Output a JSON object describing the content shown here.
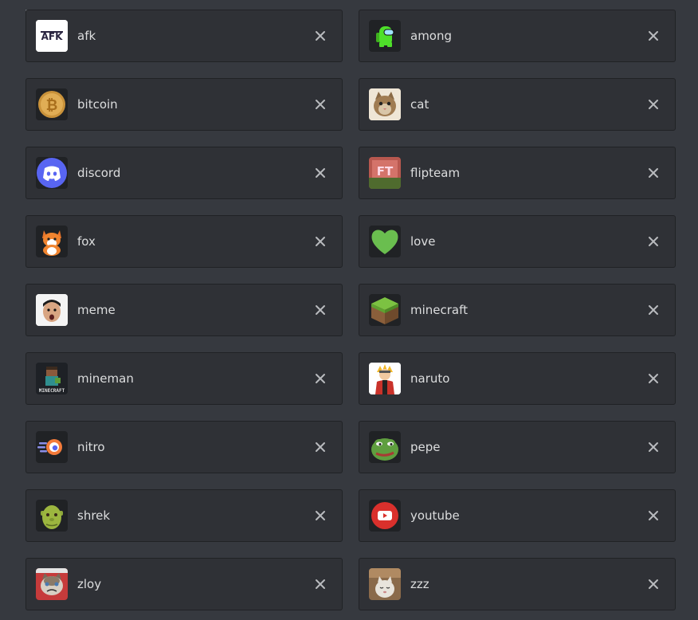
{
  "stickers": [
    {
      "name": "afk",
      "icon": "afk-logo-icon"
    },
    {
      "name": "among",
      "icon": "among-us-crewmate-icon"
    },
    {
      "name": "bitcoin",
      "icon": "bitcoin-coin-icon"
    },
    {
      "name": "cat",
      "icon": "cat-photo-icon"
    },
    {
      "name": "discord",
      "icon": "discord-logo-icon"
    },
    {
      "name": "flipteam",
      "icon": "flipteam-logo-icon"
    },
    {
      "name": "fox",
      "icon": "fox-icon"
    },
    {
      "name": "love",
      "icon": "green-heart-icon"
    },
    {
      "name": "meme",
      "icon": "meme-face-icon"
    },
    {
      "name": "minecraft",
      "icon": "minecraft-grass-block-icon"
    },
    {
      "name": "mineman",
      "icon": "minecraft-character-icon"
    },
    {
      "name": "naruto",
      "icon": "naruto-icon"
    },
    {
      "name": "nitro",
      "icon": "nitro-icon"
    },
    {
      "name": "pepe",
      "icon": "pepe-frog-icon"
    },
    {
      "name": "shrek",
      "icon": "shrek-icon"
    },
    {
      "name": "youtube",
      "icon": "youtube-logo-icon"
    },
    {
      "name": "zloy",
      "icon": "grumpy-cat-icon"
    },
    {
      "name": "zzz",
      "icon": "sleeping-cat-icon"
    }
  ],
  "colors": {
    "background": "#36393f",
    "card": "#2f3136",
    "border": "#202225",
    "text": "#dcddde",
    "close": "#b9bbbe"
  }
}
